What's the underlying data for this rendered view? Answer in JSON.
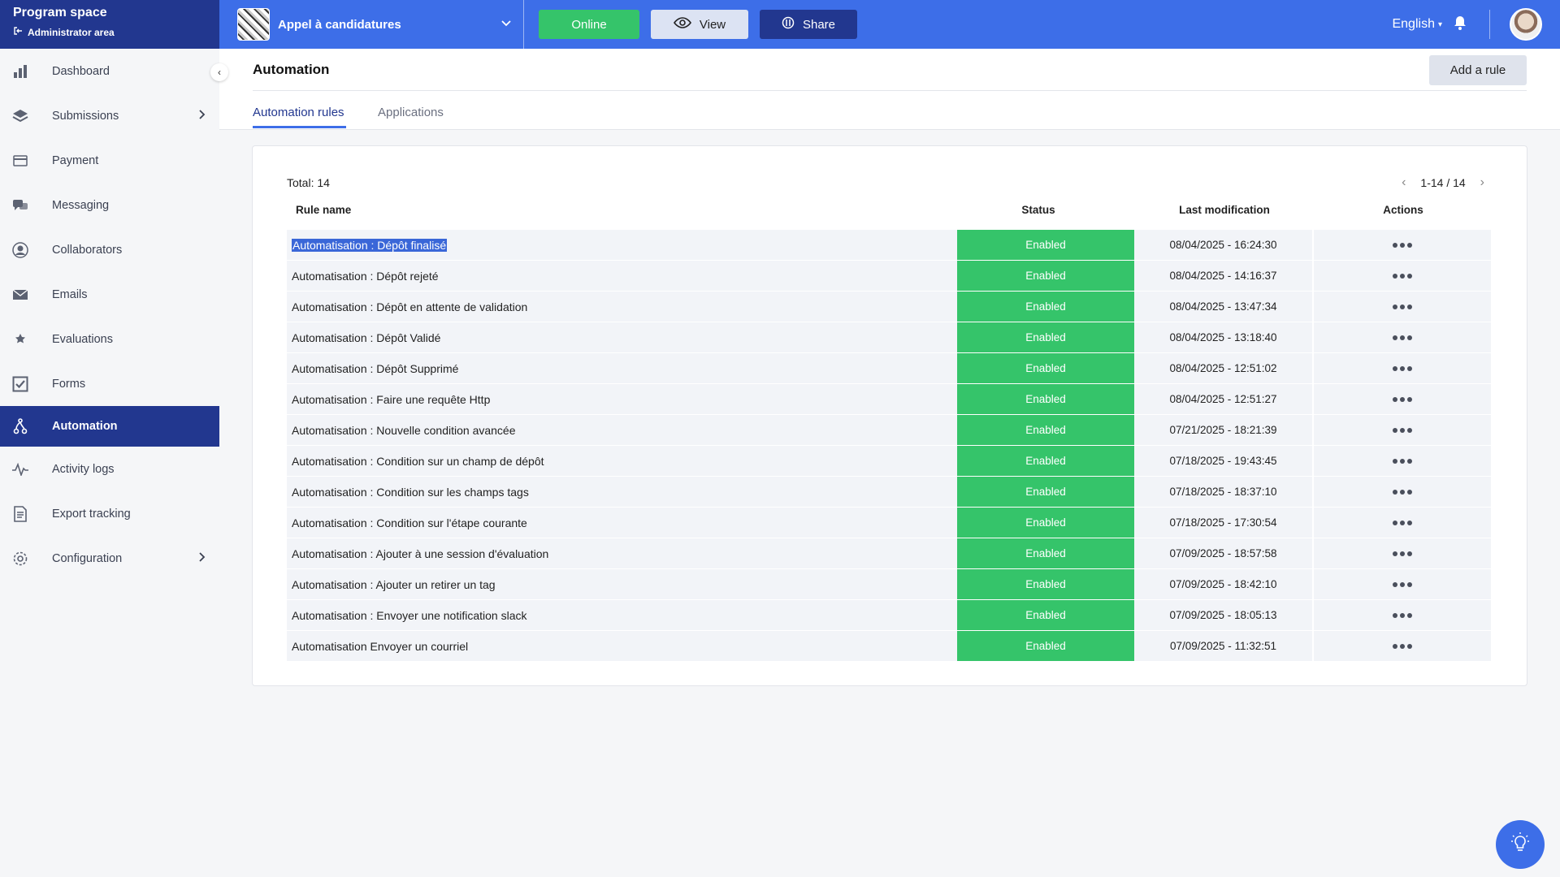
{
  "brand": {
    "title": "Program space",
    "subtitle": "Administrator area"
  },
  "sidebar": {
    "items": [
      {
        "label": "Dashboard",
        "icon": "bar-chart-icon"
      },
      {
        "label": "Submissions",
        "icon": "layers-icon",
        "has_submenu": true
      },
      {
        "label": "Payment",
        "icon": "credit-card-icon"
      },
      {
        "label": "Messaging",
        "icon": "chat-bubbles-icon"
      },
      {
        "label": "Collaborators",
        "icon": "user-circle-icon"
      },
      {
        "label": "Emails",
        "icon": "envelope-icon"
      },
      {
        "label": "Evaluations",
        "icon": "stars-icon"
      },
      {
        "label": "Forms",
        "icon": "checkbox-icon"
      },
      {
        "label": "Automation",
        "icon": "automation-icon",
        "active": true
      },
      {
        "label": "Activity logs",
        "icon": "pulse-icon"
      },
      {
        "label": "Export tracking",
        "icon": "document-icon"
      },
      {
        "label": "Configuration",
        "icon": "gear-icon",
        "has_submenu": true
      }
    ]
  },
  "topbar": {
    "program_name": "Appel à candidatures",
    "online_label": "Online",
    "view_label": "View",
    "share_label": "Share",
    "language": "English",
    "colors": {
      "bar": "#3d6ee8",
      "online": "#35c46a",
      "share": "#22378f",
      "view": "#dce3f3"
    }
  },
  "page": {
    "title": "Automation",
    "add_rule_label": "Add a rule",
    "tabs": [
      {
        "label": "Automation rules",
        "active": true
      },
      {
        "label": "Applications",
        "active": false
      }
    ]
  },
  "table": {
    "total_label": "Total: 14",
    "pagination": "1-14 / 14",
    "columns": {
      "name": "Rule name",
      "status": "Status",
      "modified": "Last modification",
      "actions": "Actions"
    },
    "rows": [
      {
        "name": "Automatisation : Dépôt finalisé",
        "status": "Enabled",
        "modified": "08/04/2025 - 16:24:30",
        "selected": true
      },
      {
        "name": "Automatisation : Dépôt rejeté",
        "status": "Enabled",
        "modified": "08/04/2025 - 14:16:37"
      },
      {
        "name": "Automatisation : Dépôt en attente de validation",
        "status": "Enabled",
        "modified": "08/04/2025 - 13:47:34"
      },
      {
        "name": "Automatisation : Dépôt Validé",
        "status": "Enabled",
        "modified": "08/04/2025 - 13:18:40"
      },
      {
        "name": "Automatisation : Dépôt Supprimé",
        "status": "Enabled",
        "modified": "08/04/2025 - 12:51:02"
      },
      {
        "name": "Automatisation : Faire une requête Http",
        "status": "Enabled",
        "modified": "08/04/2025 - 12:51:27"
      },
      {
        "name": "Automatisation : Nouvelle condition avancée",
        "status": "Enabled",
        "modified": "07/21/2025 - 18:21:39"
      },
      {
        "name": "Automatisation : Condition sur un champ de dépôt",
        "status": "Enabled",
        "modified": "07/18/2025 - 19:43:45"
      },
      {
        "name": "Automatisation : Condition sur les champs tags",
        "status": "Enabled",
        "modified": "07/18/2025 - 18:37:10"
      },
      {
        "name": "Automatisation : Condition sur l'étape courante",
        "status": "Enabled",
        "modified": "07/18/2025 - 17:30:54"
      },
      {
        "name": "Automatisation : Ajouter à une session d'évaluation",
        "status": "Enabled",
        "modified": "07/09/2025 - 18:57:58"
      },
      {
        "name": "Automatisation : Ajouter un retirer un tag",
        "status": "Enabled",
        "modified": "07/09/2025 - 18:42:10"
      },
      {
        "name": "Automatisation : Envoyer une notification slack",
        "status": "Enabled",
        "modified": "07/09/2025 - 18:05:13"
      },
      {
        "name": "Automatisation Envoyer un courriel",
        "status": "Enabled",
        "modified": "07/09/2025 - 11:32:51"
      }
    ]
  }
}
